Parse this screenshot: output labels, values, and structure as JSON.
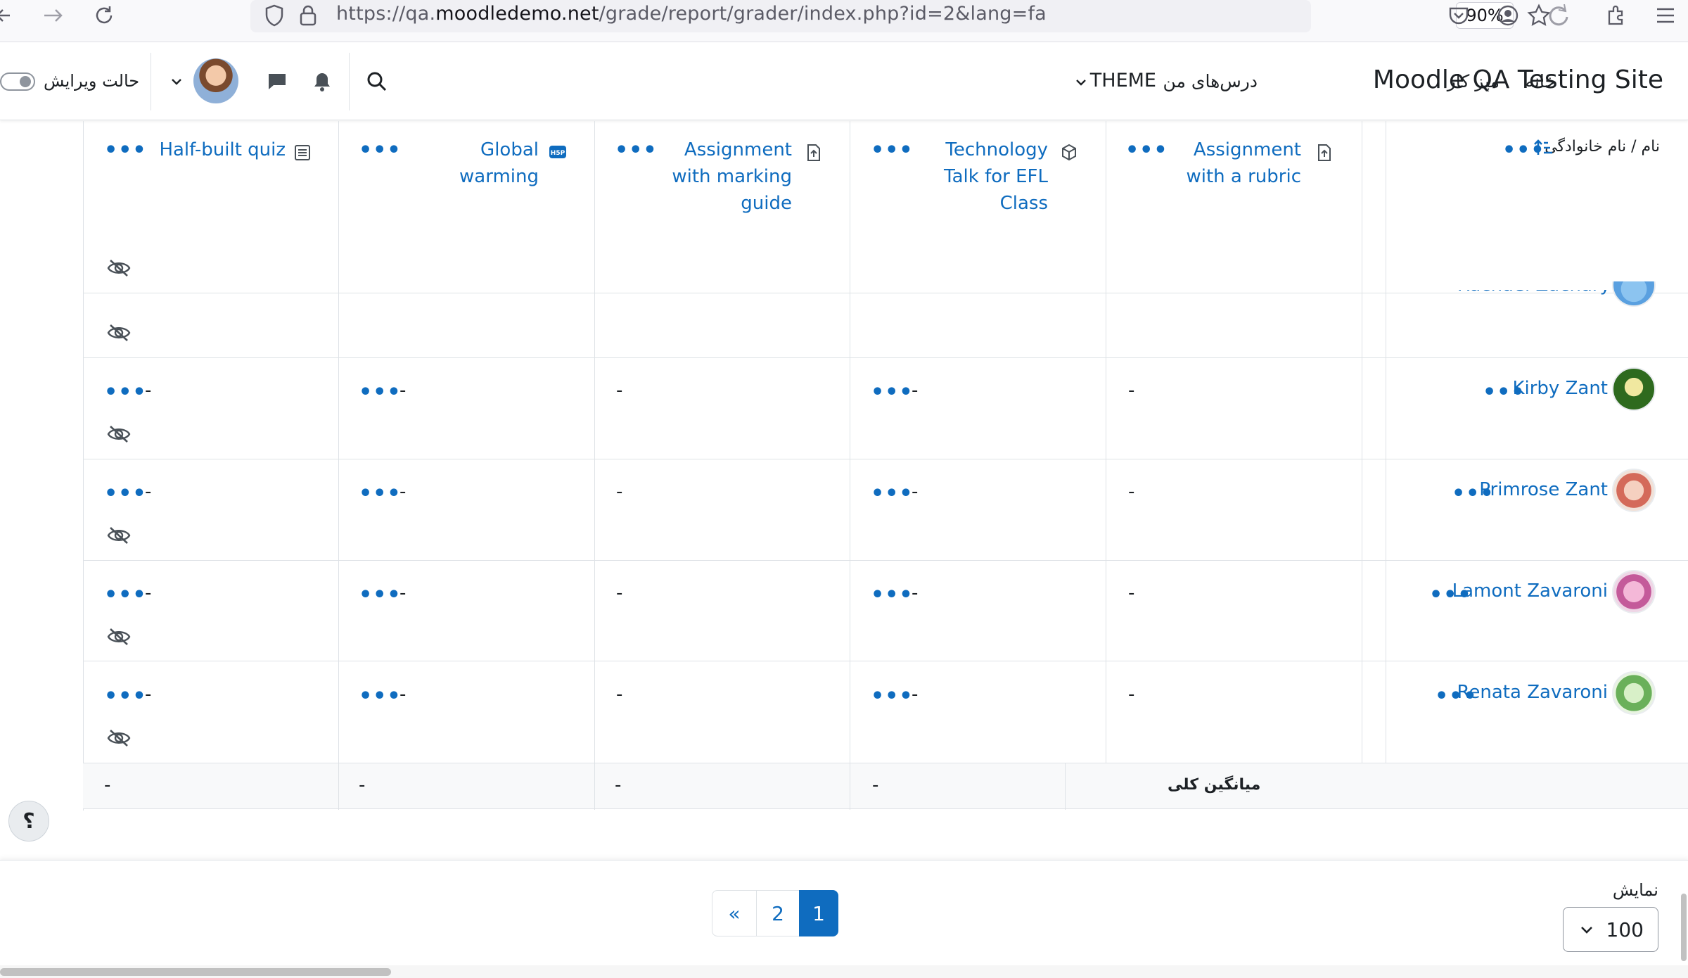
{
  "browser": {
    "url_prefix": "https://qa.",
    "url_domain": "moodledemo.net",
    "url_path": "/grade/report/grader/index.php?id=2&lang=fa",
    "zoom": "90%"
  },
  "navbar": {
    "site_name": "Moodle QA Testing Site",
    "links": [
      "خانه",
      "میز کار",
      "درس‌های من"
    ],
    "theme_label": "THEME",
    "edit_mode_label": "حالت ویرایش"
  },
  "grader": {
    "name_header": "نام / نام خانوادگی",
    "columns": [
      {
        "lines": [
          "Assignment",
          "with a rubric"
        ],
        "icon": "assignment-icon"
      },
      {
        "lines": [
          "Technology",
          "Talk for EFL",
          "Class"
        ],
        "icon": "package-icon"
      },
      {
        "lines": [
          "Assignment",
          "with marking",
          "guide"
        ],
        "icon": "assignment-icon"
      },
      {
        "lines": [
          "Global",
          "warming"
        ],
        "icon": "h5p-icon"
      },
      {
        "lines": [
          "Half-built quiz"
        ],
        "icon": "quiz-icon"
      }
    ],
    "partial_student": "Rachael Zachary",
    "students": [
      {
        "name": "Kirby Zant",
        "grades": [
          "-",
          "-",
          "-",
          "-",
          "-"
        ]
      },
      {
        "name": "Primrose Zant",
        "grades": [
          "-",
          "-",
          "-",
          "-",
          "-"
        ]
      },
      {
        "name": "Lamont Zavaroni",
        "grades": [
          "-",
          "-",
          "-",
          "-",
          "-"
        ]
      },
      {
        "name": "Renata Zavaroni",
        "grades": [
          "-",
          "-",
          "-",
          "-",
          "-"
        ]
      }
    ],
    "overall_average_label": "میانگین کلی",
    "averages": [
      "-",
      "-",
      "-",
      "-"
    ]
  },
  "pagination": {
    "prev": "«",
    "pages": [
      "2",
      "1"
    ],
    "active_page": "1",
    "show_label": "نمایش",
    "per_page": "100"
  },
  "help": {
    "label": "؟"
  },
  "colors": {
    "link": "#0f6cbf",
    "border": "#dee2e6",
    "muted": "#8f959e"
  }
}
